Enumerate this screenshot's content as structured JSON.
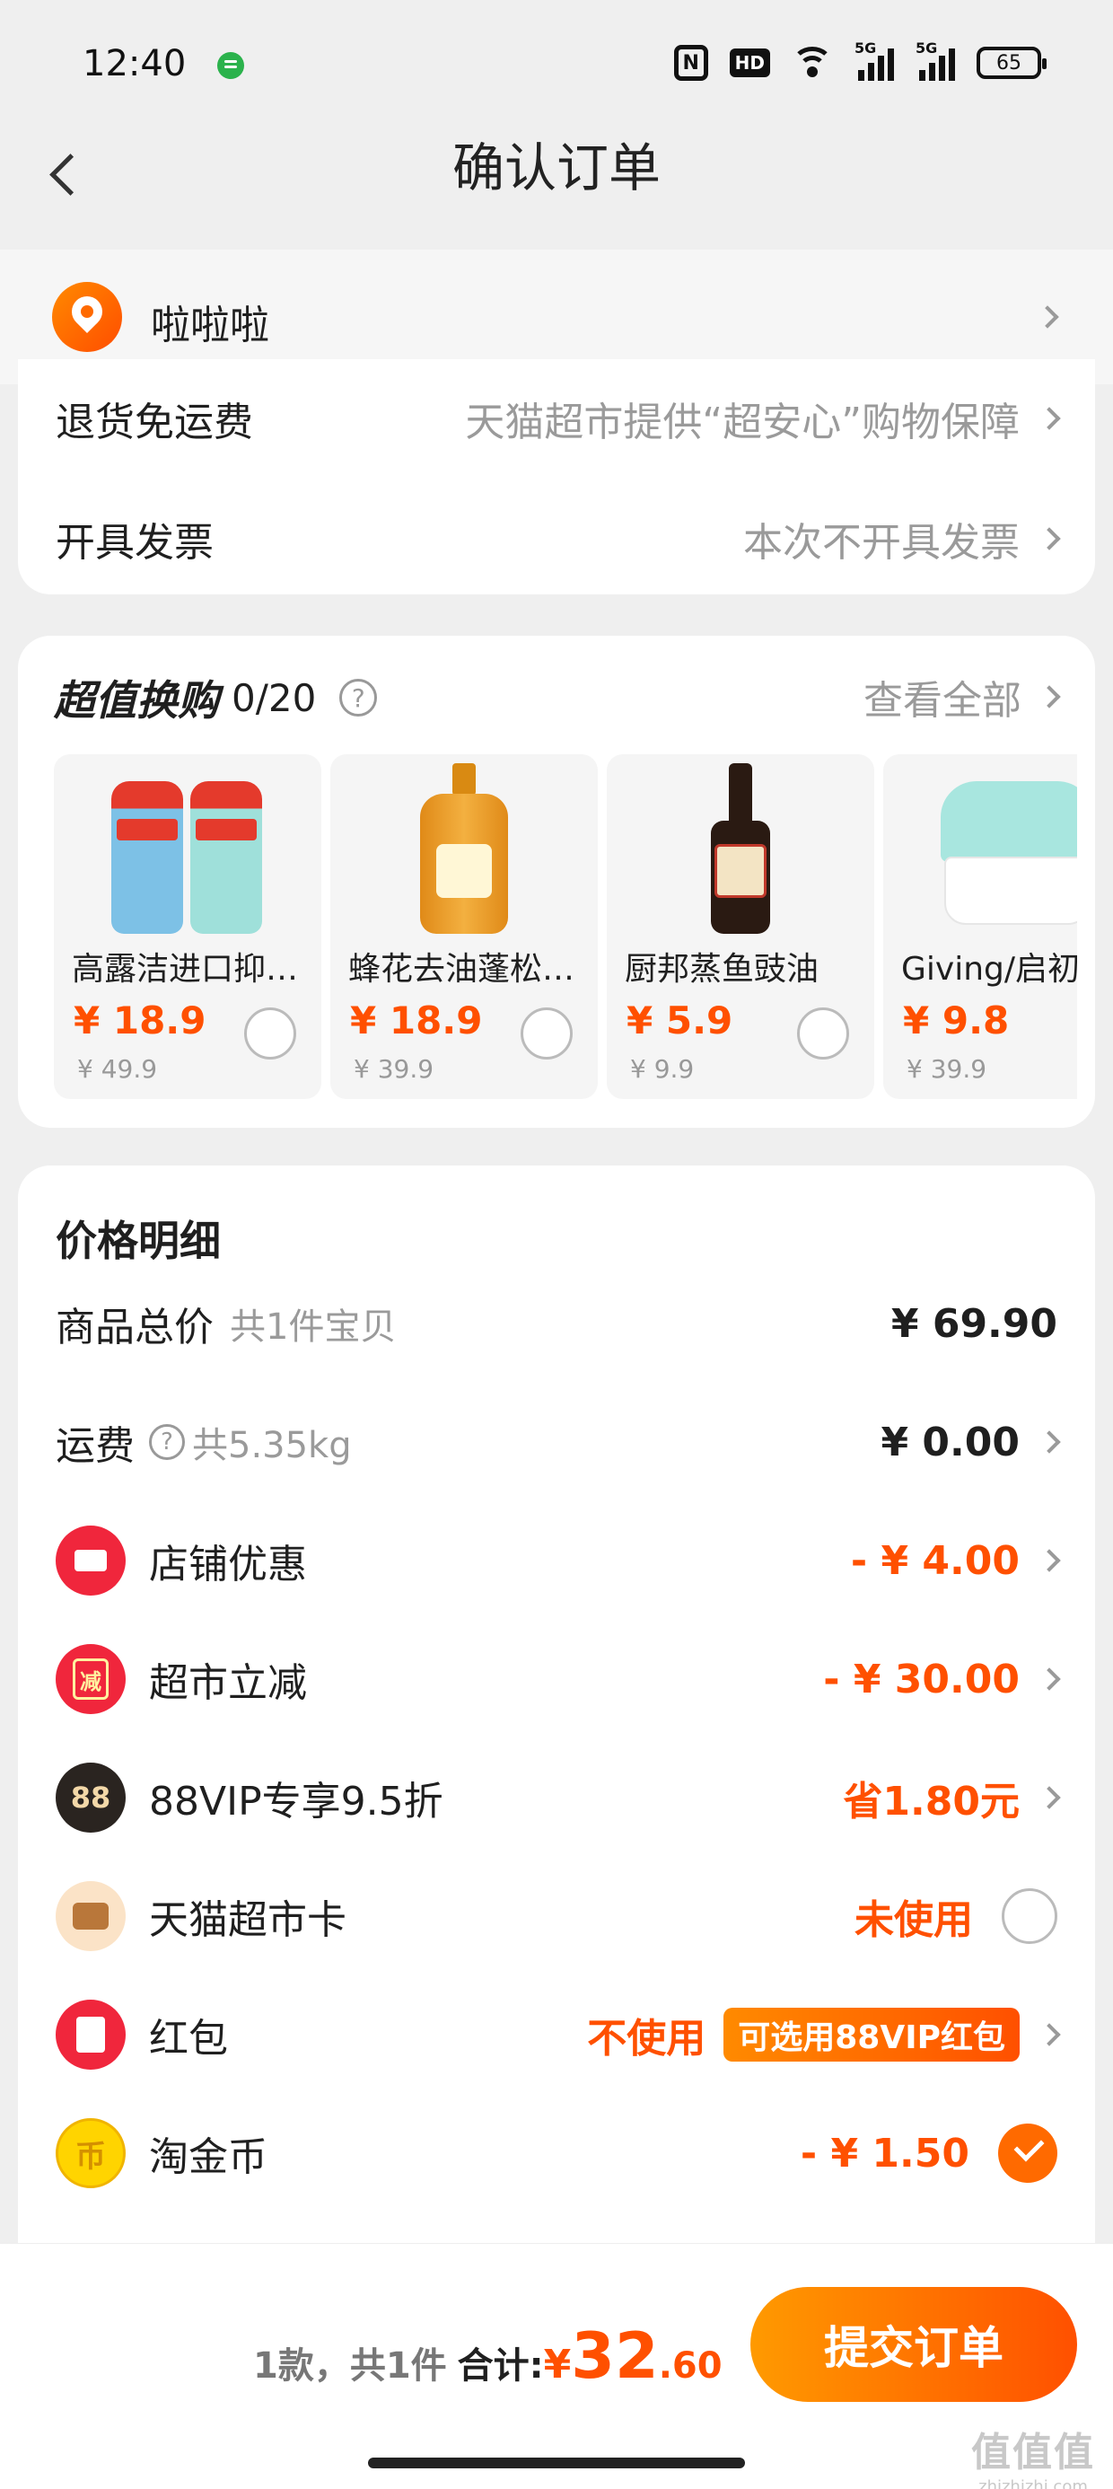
{
  "status_bar": {
    "time": "12:40",
    "battery": "65",
    "hd": "HD",
    "net1": "5G",
    "net2": "5G",
    "nfc": "N"
  },
  "header": {
    "title": "确认订单"
  },
  "address": {
    "name": "啦啦啦"
  },
  "service": {
    "return_label": "退货免运费",
    "return_value": "天猫超市提供“超安心”购物保障",
    "invoice_label": "开具发票",
    "invoice_value": "本次不开具发票"
  },
  "swap": {
    "title": "超值换购",
    "count": "0/20",
    "help": "?",
    "view_all": "查看全部",
    "products": [
      {
        "name": "高露洁进口抑菌漱口水",
        "price": "¥ 18.9",
        "original": "¥ 49.9"
      },
      {
        "name": "蜂花去油蓬松洗发露",
        "price": "¥ 18.9",
        "original": "¥ 39.9"
      },
      {
        "name": "厨邦蒸鱼豉油",
        "price": "¥ 5.9",
        "original": "¥ 9.9"
      },
      {
        "name": "Giving/启初",
        "price": "¥ 9.8",
        "original": "¥ 39.9"
      }
    ]
  },
  "price_detail": {
    "title": "价格明细",
    "goods_label": "商品总价",
    "goods_sub": "共1件宝贝",
    "goods_amount": "¥ 69.90",
    "shipping_label": "运费",
    "shipping_help": "?",
    "shipping_sub": "共5.35kg",
    "shipping_amount": "¥ 0.00",
    "shop_label": "店铺优惠",
    "shop_amount": "- ¥ 4.00",
    "cut_label": "超市立减",
    "cut_icon": "减",
    "cut_amount": "- ¥ 30.00",
    "vip_label": "88VIP专享9.5折",
    "vip_icon": "88",
    "vip_amount": "省1.80元",
    "card_label": "天猫超市卡",
    "card_status": "未使用",
    "redpacket_label": "红包",
    "redpacket_status": "不使用",
    "redpacket_tag": "可选用88VIP红包",
    "coin_label": "淘金币",
    "coin_icon": "币",
    "coin_amount": "- ¥ 1.50"
  },
  "footer": {
    "count": "1款，共1件",
    "total_label": "合计:",
    "currency": "¥",
    "total_int": "32",
    "total_dec": ".60",
    "submit_label": "提交订单",
    "watermark": "值值值",
    "watermark_url": "zhizhizhi.com"
  },
  "colors": {
    "accent": "#ff5000",
    "red_icon": "#f0263c",
    "background": "#efefef"
  }
}
